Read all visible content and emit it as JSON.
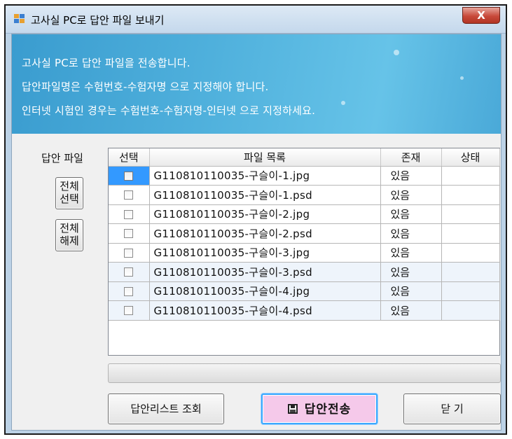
{
  "window": {
    "title": "고사실 PC로 답안 파일 보내기",
    "close_label": "X"
  },
  "banner": {
    "line1": "고사실 PC로 답안 파일을 전송합니다.",
    "line2": "답안파일명은 수험번호-수험자명 으로 지정해야 합니다.",
    "line3": "인터넷 시험인 경우는 수험번호-수험자명-인터넷 으로 지정하세요."
  },
  "left_panel": {
    "label": "답안 파일",
    "select_all": "전체\n선택",
    "select_all_line1": "전체",
    "select_all_line2": "선택",
    "deselect_all_line1": "전체",
    "deselect_all_line2": "해제"
  },
  "grid": {
    "columns": [
      "선택",
      "파일 목록",
      "존재",
      "상태"
    ],
    "rows": [
      {
        "checked": false,
        "file": "G110810110035-구슬이-1.jpg",
        "exists": "있음",
        "status": ""
      },
      {
        "checked": false,
        "file": "G110810110035-구슬이-1.psd",
        "exists": "있음",
        "status": ""
      },
      {
        "checked": false,
        "file": "G110810110035-구슬이-2.jpg",
        "exists": "있음",
        "status": ""
      },
      {
        "checked": false,
        "file": "G110810110035-구슬이-2.psd",
        "exists": "있음",
        "status": ""
      },
      {
        "checked": false,
        "file": "G110810110035-구슬이-3.jpg",
        "exists": "있음",
        "status": ""
      },
      {
        "checked": false,
        "file": "G110810110035-구슬이-3.psd",
        "exists": "있음",
        "status": ""
      },
      {
        "checked": false,
        "file": "G110810110035-구슬이-4.jpg",
        "exists": "있음",
        "status": ""
      },
      {
        "checked": false,
        "file": "G110810110035-구슬이-4.psd",
        "exists": "있음",
        "status": ""
      }
    ]
  },
  "progress": {
    "value": 0
  },
  "buttons": {
    "list": "답안리스트 조회",
    "send": "답안전송",
    "close": "닫 기"
  },
  "colors": {
    "banner": "#4fb0dc",
    "send_button": "#f5c9ea",
    "selection": "#3399ff"
  }
}
